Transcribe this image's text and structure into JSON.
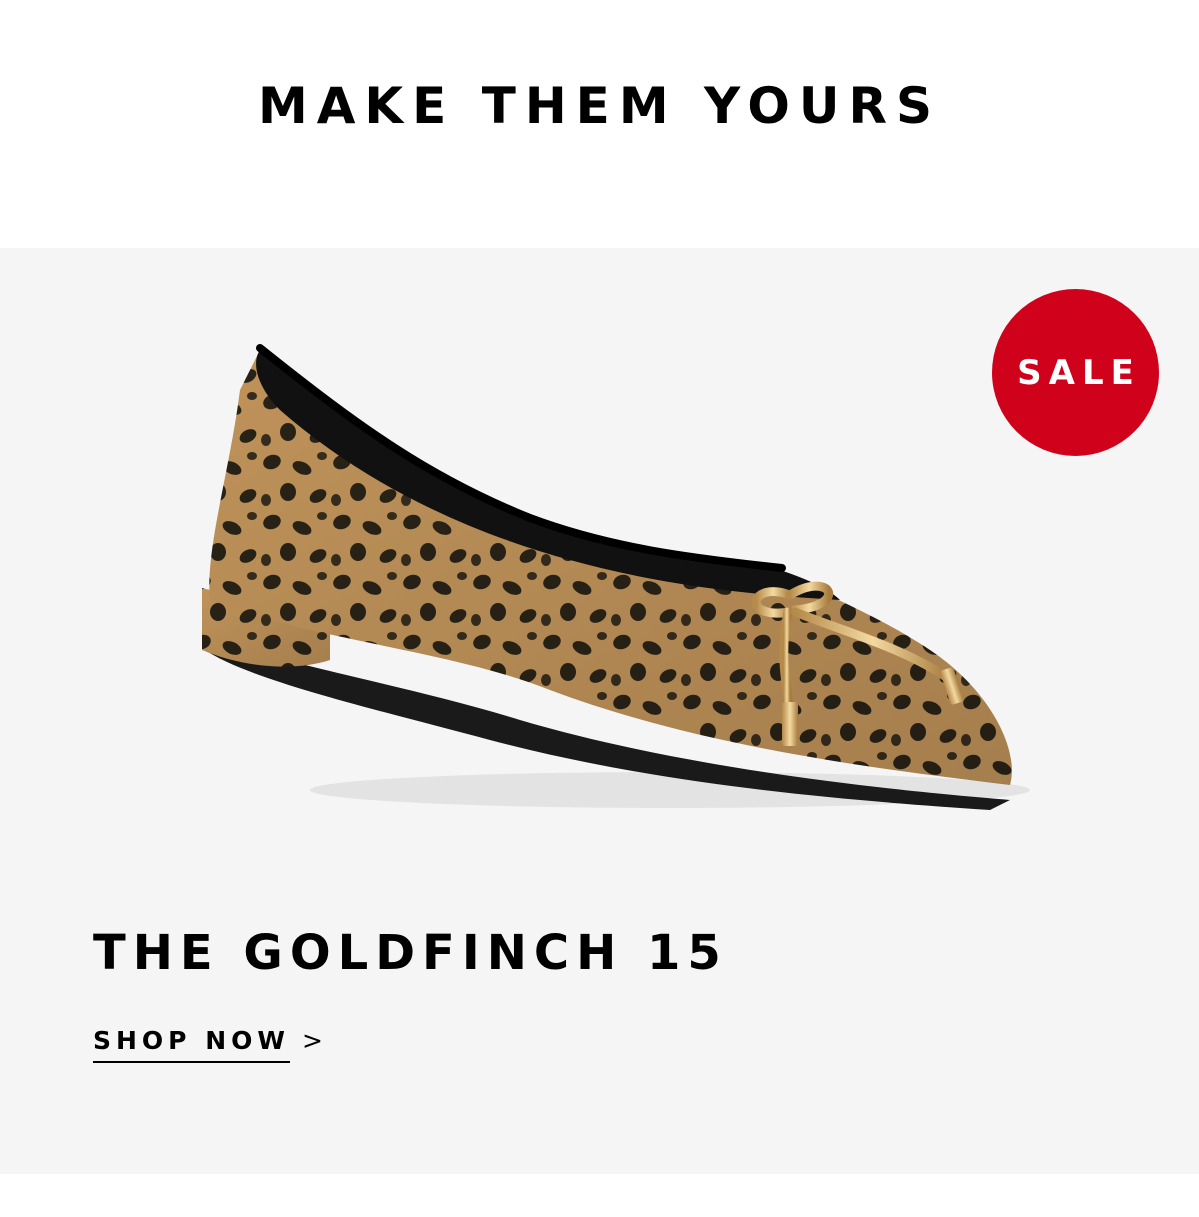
{
  "header": {
    "headline": "MAKE THEM YOURS"
  },
  "product": {
    "badge": "SALE",
    "image_icon": "leopard-print-pointed-flat-shoe",
    "title": "THE GOLDFINCH 15",
    "cta_label": "SHOP NOW",
    "cta_chevron": ">"
  },
  "colors": {
    "badge_red": "#d0021b",
    "panel_gray": "#f5f5f5",
    "text_black": "#000000"
  }
}
